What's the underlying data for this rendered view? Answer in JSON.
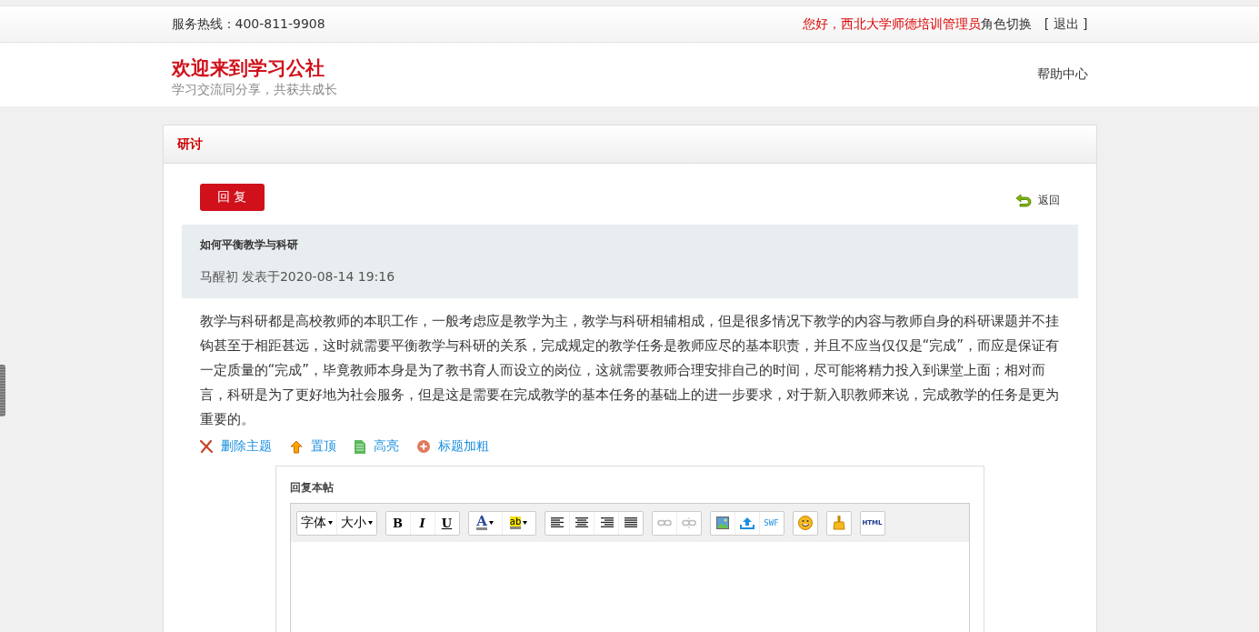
{
  "top_bar": {
    "hotline": "服务热线：400-811-9908",
    "greeting": "您好，西北大学师德培训管理员",
    "role_switch": "角色切换",
    "logout": "[ 退出 ]"
  },
  "header": {
    "title": "欢迎来到学习公社",
    "slogan": "学习交流同分享，共获共成长",
    "help": "帮助中心"
  },
  "panel": {
    "title": "研讨"
  },
  "reply_button": "回 复",
  "back_link": "返回",
  "post": {
    "title": "如何平衡教学与科研",
    "meta": "马醒初 发表于2020-08-14 19:16",
    "body": "教学与科研都是高校教师的本职工作，一般考虑应是教学为主，教学与科研相辅相成，但是很多情况下教学的内容与教师自身的科研课题并不挂钩甚至于相距甚远，这时就需要平衡教学与科研的关系，完成规定的教学任务是教师应尽的基本职责，并且不应当仅仅是“完成”，而应是保证有一定质量的“完成”，毕竟教师本身是为了教书育人而设立的岗位，这就需要教师合理安排自己的时间，尽可能将精力投入到课堂上面；相对而言，科研是为了更好地为社会服务，但是这是需要在完成教学的基本任务的基础上的进一步要求，对于新入职教师来说，完成教学的任务是更为重要的。"
  },
  "actions": [
    {
      "kind": "delete",
      "label": "删除主题"
    },
    {
      "kind": "pin",
      "label": "置顶"
    },
    {
      "kind": "highlight",
      "label": "高亮"
    },
    {
      "kind": "bold",
      "label": "标题加粗"
    }
  ],
  "editor": {
    "label": "回复本帖",
    "toolbar": [
      [
        {
          "kind": "dropdown",
          "label": "字体"
        },
        {
          "kind": "dropdown",
          "label": "大小"
        }
      ],
      [
        {
          "kind": "bold",
          "label": "B"
        },
        {
          "kind": "italic",
          "label": "I"
        },
        {
          "kind": "underline",
          "label": "U"
        }
      ],
      [
        {
          "kind": "font-color",
          "label": "A"
        },
        {
          "kind": "highlight",
          "label": "ab"
        }
      ],
      [
        {
          "kind": "align-left"
        },
        {
          "kind": "align-center"
        },
        {
          "kind": "align-right"
        },
        {
          "kind": "justify"
        }
      ],
      [
        {
          "kind": "link",
          "disabled": true
        },
        {
          "kind": "unlink",
          "disabled": true
        }
      ],
      [
        {
          "kind": "image"
        },
        {
          "kind": "upload"
        },
        {
          "kind": "swf",
          "label": "SWF"
        }
      ],
      [
        {
          "kind": "emoticon"
        }
      ],
      [
        {
          "kind": "clear"
        }
      ],
      [
        {
          "kind": "html",
          "label": "HTML"
        }
      ]
    ]
  }
}
